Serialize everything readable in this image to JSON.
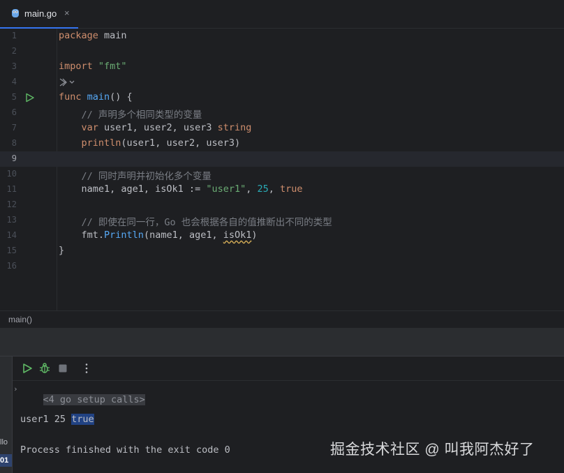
{
  "tab": {
    "file_name": "main.go",
    "close_glyph": "×"
  },
  "editor": {
    "lines": [
      {
        "n": "1",
        "tokens": [
          {
            "c": "kw",
            "t": "package"
          },
          {
            "c": "",
            "t": " main"
          }
        ]
      },
      {
        "n": "2",
        "tokens": []
      },
      {
        "n": "3",
        "tokens": [
          {
            "c": "kw",
            "t": "import"
          },
          {
            "c": "",
            "t": " "
          },
          {
            "c": "str",
            "t": "\"fmt\""
          }
        ]
      },
      {
        "n": "4",
        "tokens": []
      },
      {
        "n": "5",
        "tokens": [
          {
            "c": "kw",
            "t": "func"
          },
          {
            "c": "",
            "t": " "
          },
          {
            "c": "fn",
            "t": "main"
          },
          {
            "c": "",
            "t": "() {"
          }
        ]
      },
      {
        "n": "6",
        "tokens": [
          {
            "c": "",
            "t": "    "
          },
          {
            "c": "cm",
            "t": "// 声明多个相同类型的变量"
          }
        ]
      },
      {
        "n": "7",
        "tokens": [
          {
            "c": "",
            "t": "    "
          },
          {
            "c": "kw",
            "t": "var"
          },
          {
            "c": "",
            "t": " user1, user2, user3 "
          },
          {
            "c": "kw",
            "t": "string"
          }
        ]
      },
      {
        "n": "8",
        "tokens": [
          {
            "c": "",
            "t": "    "
          },
          {
            "c": "kw",
            "t": "println"
          },
          {
            "c": "",
            "t": "(user1, user2, user3)"
          }
        ]
      },
      {
        "n": "9",
        "tokens": [],
        "current": true
      },
      {
        "n": "10",
        "tokens": [
          {
            "c": "",
            "t": "    "
          },
          {
            "c": "cm",
            "t": "// 同时声明并初始化多个变量"
          }
        ]
      },
      {
        "n": "11",
        "tokens": [
          {
            "c": "",
            "t": "    name1, age1, isOk1 := "
          },
          {
            "c": "str",
            "t": "\"user1\""
          },
          {
            "c": "",
            "t": ", "
          },
          {
            "c": "num",
            "t": "25"
          },
          {
            "c": "",
            "t": ", "
          },
          {
            "c": "kw",
            "t": "true"
          }
        ]
      },
      {
        "n": "12",
        "tokens": []
      },
      {
        "n": "13",
        "tokens": [
          {
            "c": "",
            "t": "    "
          },
          {
            "c": "cm",
            "t": "// 即使在同一行，Go 也会根据各自的值推断出不同的类型"
          }
        ]
      },
      {
        "n": "14",
        "tokens": [
          {
            "c": "",
            "t": "    fmt."
          },
          {
            "c": "fn",
            "t": "Println"
          },
          {
            "c": "",
            "t": "(name1, age1, "
          },
          {
            "c": "warn",
            "t": "isOk1"
          },
          {
            "c": "",
            "t": ")"
          }
        ]
      },
      {
        "n": "15",
        "tokens": [
          {
            "c": "",
            "t": "}"
          }
        ]
      },
      {
        "n": "16",
        "tokens": []
      }
    ],
    "inlay_hint_icon": "run-config-chevron-icon",
    "run_gutter_icon": "run-triangle-icon"
  },
  "breadcrumb": {
    "text": "main()"
  },
  "run_panel": {
    "left_strip": [
      "llo",
      "01"
    ],
    "console": {
      "setup_calls": "<4 go setup calls>",
      "output_prefix": "user1 25 ",
      "output_highlight": "true",
      "exit_message": "Process finished with the exit code 0"
    }
  },
  "watermark": "掘金技术社区 @ 叫我阿杰好了",
  "colors": {
    "background": "#1e1f22",
    "keyword": "#cf8e6d",
    "function": "#56a8f5",
    "string": "#6aab73",
    "number": "#2aacb8",
    "comment": "#7a7e85",
    "run_green": "#5fb865",
    "selection_blue": "#214283"
  }
}
